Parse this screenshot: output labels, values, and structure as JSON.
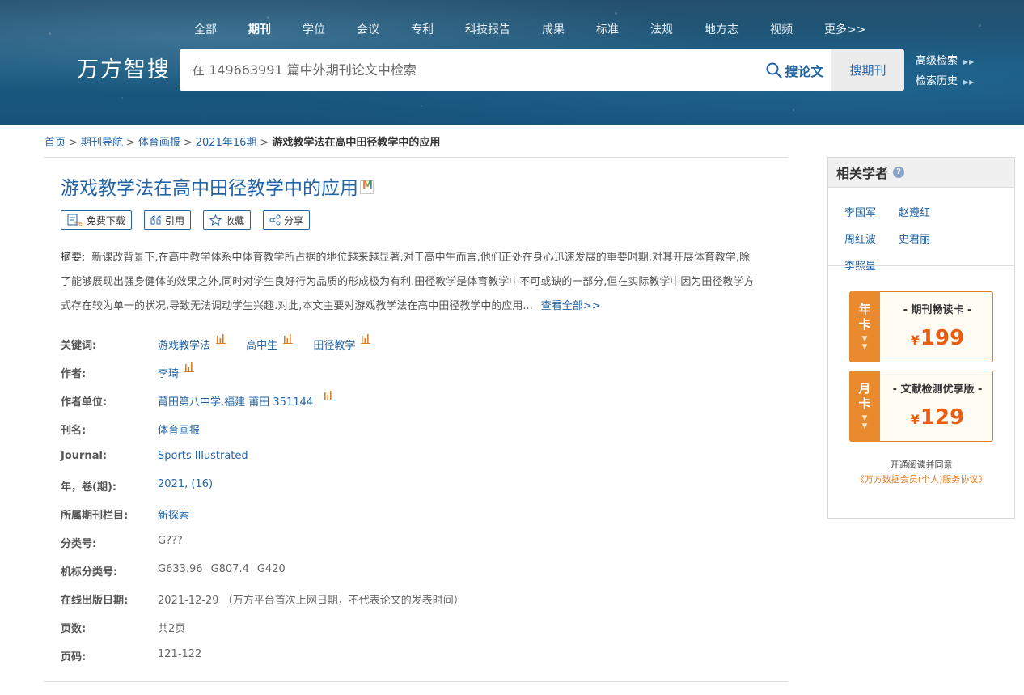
{
  "header": {
    "nav": [
      {
        "label": "全部",
        "active": false
      },
      {
        "label": "期刊",
        "active": true
      },
      {
        "label": "学位",
        "active": false
      },
      {
        "label": "会议",
        "active": false
      },
      {
        "label": "专利",
        "active": false
      },
      {
        "label": "科技报告",
        "active": false
      },
      {
        "label": "成果",
        "active": false
      },
      {
        "label": "标准",
        "active": false
      },
      {
        "label": "法规",
        "active": false
      },
      {
        "label": "地方志",
        "active": false
      },
      {
        "label": "视频",
        "active": false
      },
      {
        "label": "更多>>",
        "active": false
      }
    ],
    "brand": "万方智搜",
    "search": {
      "value": "",
      "placeholder": "在 149663991 篇中外期刊论文中检索",
      "button_label": "搜论文",
      "journal_button_label": "搜期刊"
    },
    "side_links": [
      {
        "label": "高级检索"
      },
      {
        "label": "检索历史"
      }
    ]
  },
  "breadcrumb": {
    "items": [
      {
        "label": "首页"
      },
      {
        "label": "期刊导航"
      },
      {
        "label": "体育画报"
      },
      {
        "label": "2021年16期"
      }
    ],
    "separator": ">",
    "current": "游戏教学法在高中田径教学中的应用"
  },
  "article": {
    "title": "游戏教学法在高中田径教学中的应用",
    "badge": "M",
    "actions": [
      {
        "label": "免费下载",
        "icon": "free-download-icon"
      },
      {
        "label": "引用",
        "icon": "quote-icon"
      },
      {
        "label": "收藏",
        "icon": "star-icon"
      },
      {
        "label": "分享",
        "icon": "share-icon"
      }
    ],
    "abstract_label": "摘要:",
    "abstract": "新课改背景下,在高中教学体系中体育教学所占据的地位越来越显著.对于高中生而言,他们正处在身心迅速发展的重要时期,对其开展体育教学,除了能够展现出强身健体的效果之外,同时对学生良好行为品质的形成极为有利.田径教学是体育教学中不可或缺的一部分,但在实际教学中因为田径教学方式存在较为单一的状况,导致无法调动学生兴趣.对此,本文主要对游戏教学法在高中田径教学中的应用...",
    "abstract_more": "查看全部>>",
    "meta": {
      "keywords_label": "关键词:",
      "keywords": [
        "游戏教学法",
        "高中生",
        "田径教学"
      ],
      "author_label": "作者:",
      "author": "李琦",
      "unit_label": "作者单位:",
      "unit": "莆田第八中学,福建 莆田 351144",
      "journal_cn_label": "刊名:",
      "journal_cn": "体育画报",
      "journal_en_label": "Journal:",
      "journal_en": "Sports Illustrated",
      "year_issue_label": "年，卷(期):",
      "year_issue": "2021, (16)",
      "column_label": "所属期刊栏目:",
      "column": "新探索",
      "class_label": "分类号:",
      "class": "G???",
      "machine_class_label": "机标分类号:",
      "machine_class": [
        "G633.96",
        "G807.4",
        "G420"
      ],
      "online_date_label": "在线出版日期:",
      "online_date": "2021-12-29",
      "online_date_note": "（万方平台首次上网日期，不代表论文的发表时间）",
      "pages_label": "页数:",
      "pages": "共2页",
      "page_range_label": "页码:",
      "page_range": "121-122"
    }
  },
  "sidebar": {
    "scholars_title": "相关学者",
    "scholars": [
      {
        "name": "李国军"
      },
      {
        "name": "赵遵红"
      },
      {
        "name": "周红波"
      },
      {
        "name": "史君丽"
      },
      {
        "name": "李照星"
      }
    ],
    "cards": [
      {
        "tab_top": "年",
        "tab_bottom": "卡",
        "title": "- 期刊畅读卡 -",
        "currency": "¥",
        "price": "199"
      },
      {
        "tab_top": "月",
        "tab_bottom": "卡",
        "title": "- 文献检测优享版 -",
        "currency": "¥",
        "price": "129"
      }
    ],
    "agree_text": "开通阅读并同意",
    "agree_link": "《万方数据会员(个人)服务协议》"
  },
  "colors": {
    "link": "#2464a6",
    "accent_orange": "#e98a2e",
    "price": "#e85d12",
    "header_bg": "#1b5a80"
  }
}
